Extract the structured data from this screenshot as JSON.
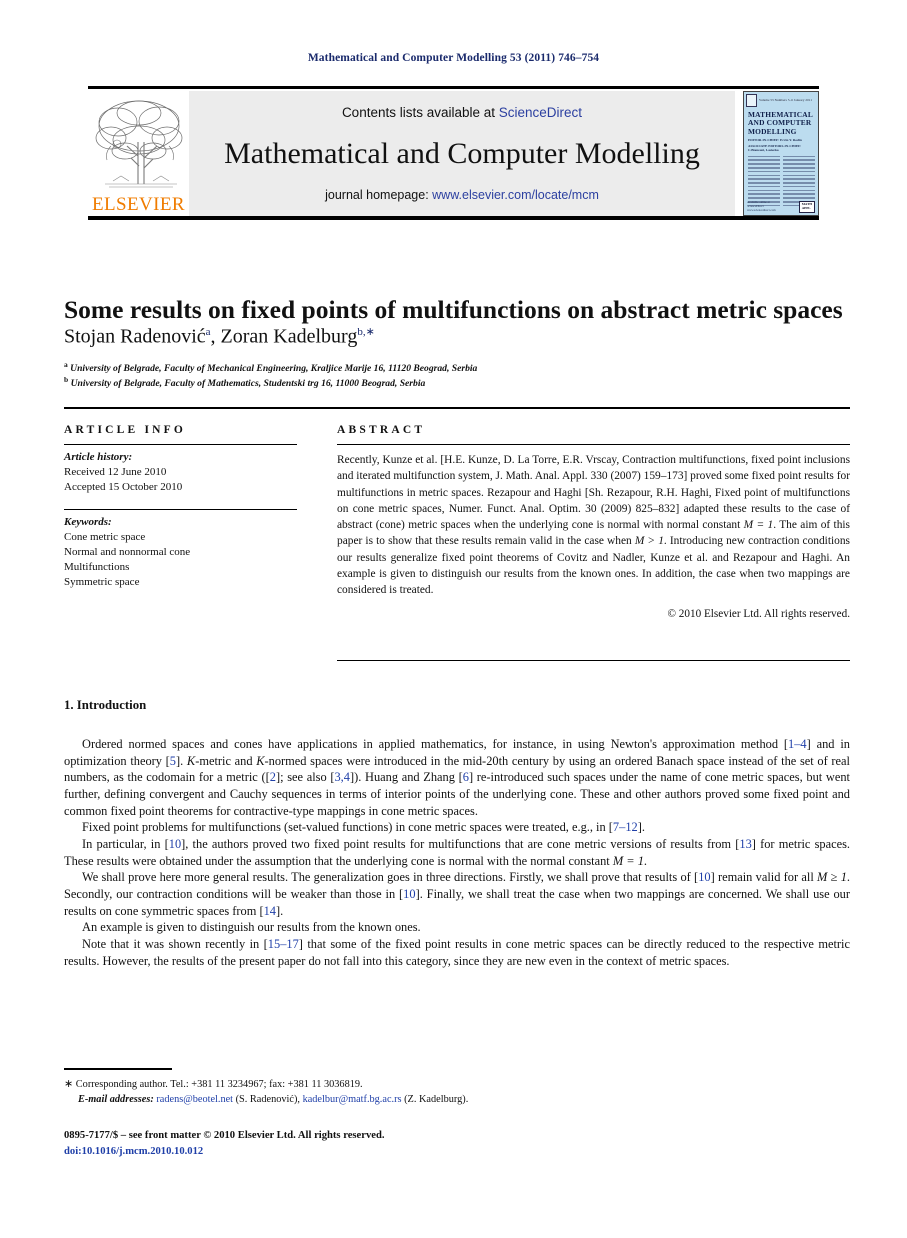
{
  "running_head": "Mathematical and Computer Modelling 53 (2011) 746–754",
  "banner": {
    "publisher_name": "ELSEVIER",
    "contents_prefix": "Contents lists available at ",
    "contents_link": "ScienceDirect",
    "journal_title": "Mathematical and Computer Modelling",
    "homepage_prefix": "journal homepage: ",
    "homepage_url": "www.elsevier.com/locate/mcm",
    "cover": {
      "title_line1": "MATHEMATICAL",
      "title_line2": "AND COMPUTER",
      "title_line3": "MODELLING",
      "editors_line1": "EDITOR-IN-CHIEF: Ervin Y. Rodin",
      "editors_line2": "ASSOCIATE EDITORS-IN-CHIEF: C.Bianconi, Lasiecka",
      "bottom_left1": "Available online at",
      "bottom_left2": "ScienceDirect",
      "bottom_left3": "www.sciencedirect.com",
      "bottom_right1": "ELSEVIER",
      "bottom_right2": "MATH",
      "bottom_right3": "APPL"
    }
  },
  "article": {
    "title": "Some results on fixed points of multifunctions on abstract metric spaces",
    "authors": [
      {
        "name": "Stojan Radenović",
        "marker": "a"
      },
      {
        "name": "Zoran Kadelburg",
        "marker": "b,∗"
      }
    ],
    "authors_separator": ", ",
    "affiliations": [
      {
        "marker": "a",
        "text": "University of Belgrade, Faculty of Mechanical Engineering, Kraljice Marije 16, 11120 Beograd, Serbia"
      },
      {
        "marker": "b",
        "text": "University of Belgrade, Faculty of Mathematics, Studentski trg 16, 11000 Beograd, Serbia"
      }
    ]
  },
  "article_info": {
    "heading": "ARTICLE INFO",
    "history_label": "Article history:",
    "received": "Received 12 June 2010",
    "accepted": "Accepted 15 October 2010",
    "keywords_label": "Keywords:",
    "keywords": [
      "Cone metric space",
      "Normal and nonnormal cone",
      "Multifunctions",
      "Symmetric space"
    ]
  },
  "abstract": {
    "heading": "ABSTRACT",
    "part1": "Recently, Kunze et al. [H.E. Kunze, D. La Torre, E.R. Vrscay, Contraction multifunctions, fixed point inclusions and iterated multifunction system, J. Math. Anal. Appl. 330 (2007) 159–173] proved some fixed point results for multifunctions in metric spaces. Rezapour and Haghi [Sh. Rezapour, R.H. Haghi, Fixed point of multifunctions on cone metric spaces, Numer. Funct. Anal. Optim. 30 (2009) 825–832] adapted these results to the case of abstract (cone) metric spaces when the underlying cone is normal with normal constant ",
    "math1": "M = 1",
    "part2": ". The aim of this paper is to show that these results remain valid in the case when ",
    "math2": "M > 1",
    "part3": ". Introducing new contraction conditions our results generalize fixed point theorems of Covitz and Nadler, Kunze et al. and Rezapour and Haghi. An example is given to distinguish our results from the known ones. In addition, the case when two mappings are considered is treated.",
    "copyright": "© 2010 Elsevier Ltd. All rights reserved."
  },
  "introduction": {
    "heading": "1. Introduction",
    "p1_a": "Ordered normed spaces and cones have applications in applied mathematics, for instance, in using Newton's approximation method [",
    "p1_ref1": "1–4",
    "p1_b": "] and in optimization theory [",
    "p1_ref2": "5",
    "p1_c": "]. ",
    "p1_math1": "K",
    "p1_d": "-metric and ",
    "p1_math2": "K",
    "p1_e": "-normed spaces were introduced in the mid-20th century by using an ordered Banach space instead of the set of real numbers, as the codomain for a metric ([",
    "p1_ref3": "2",
    "p1_f": "]; see also [",
    "p1_ref4": "3,4",
    "p1_g": "]). Huang and Zhang [",
    "p1_ref5": "6",
    "p1_h": "] re-introduced such spaces under the name of cone metric spaces, but went further, defining convergent and Cauchy sequences in terms of interior points of the underlying cone. These and other authors proved some fixed point and common fixed point theorems for contractive-type mappings in cone metric spaces.",
    "p2_a": "Fixed point problems for multifunctions (set-valued functions) in cone metric spaces were treated, e.g., in [",
    "p2_ref1": "7–12",
    "p2_b": "].",
    "p3_a": "In particular, in [",
    "p3_ref1": "10",
    "p3_b": "], the authors proved two fixed point results for multifunctions that are cone metric versions of results from [",
    "p3_ref2": "13",
    "p3_c": "] for metric spaces. These results were obtained under the assumption that the underlying cone is normal with the normal constant ",
    "p3_math": "M = 1",
    "p3_d": ".",
    "p4_a": "We shall prove here more general results. The generalization goes in three directions. Firstly, we shall prove that results of [",
    "p4_ref1": "10",
    "p4_b": "] remain valid for all ",
    "p4_math": "M ≥ 1",
    "p4_c": ". Secondly, our contraction conditions will be weaker than those in [",
    "p4_ref2": "10",
    "p4_d": "]. Finally, we shall treat the case when two mappings are concerned. We shall use our results on cone symmetric spaces from [",
    "p4_ref3": "14",
    "p4_e": "].",
    "p5": "An example is given to distinguish our results from the known ones.",
    "p6_a": "Note that it was shown recently in [",
    "p6_ref1": "15–17",
    "p6_b": "] that some of the fixed point results in cone metric spaces can be directly reduced to the respective metric results. However, the results of the present paper do not fall into this category, since they are new even in the context of metric spaces."
  },
  "footnotes": {
    "corresponding_marker": "∗",
    "corresponding_text": "Corresponding author. Tel.: +381 11 3234967; fax: +381 11 3036819.",
    "email_label": "E-mail addresses:",
    "email1": "radens@beotel.net",
    "email1_owner": "(S. Radenović)",
    "email_separator": ", ",
    "email2": "kadelbur@matf.bg.ac.rs",
    "email2_owner": "(Z. Kadelburg)",
    "email_end": "."
  },
  "footer": {
    "issn_line": "0895-7177/$ – see front matter © 2010 Elsevier Ltd. All rights reserved.",
    "doi_line": "doi:10.1016/j.mcm.2010.10.012"
  },
  "colors": {
    "link": "#2b3fa0",
    "reference": "#1f3fa8",
    "running_head": "#1a2a6c",
    "elsevier_orange": "#F07C00",
    "banner_bg": "#ececec",
    "cover_bg": "#bcdcef"
  }
}
